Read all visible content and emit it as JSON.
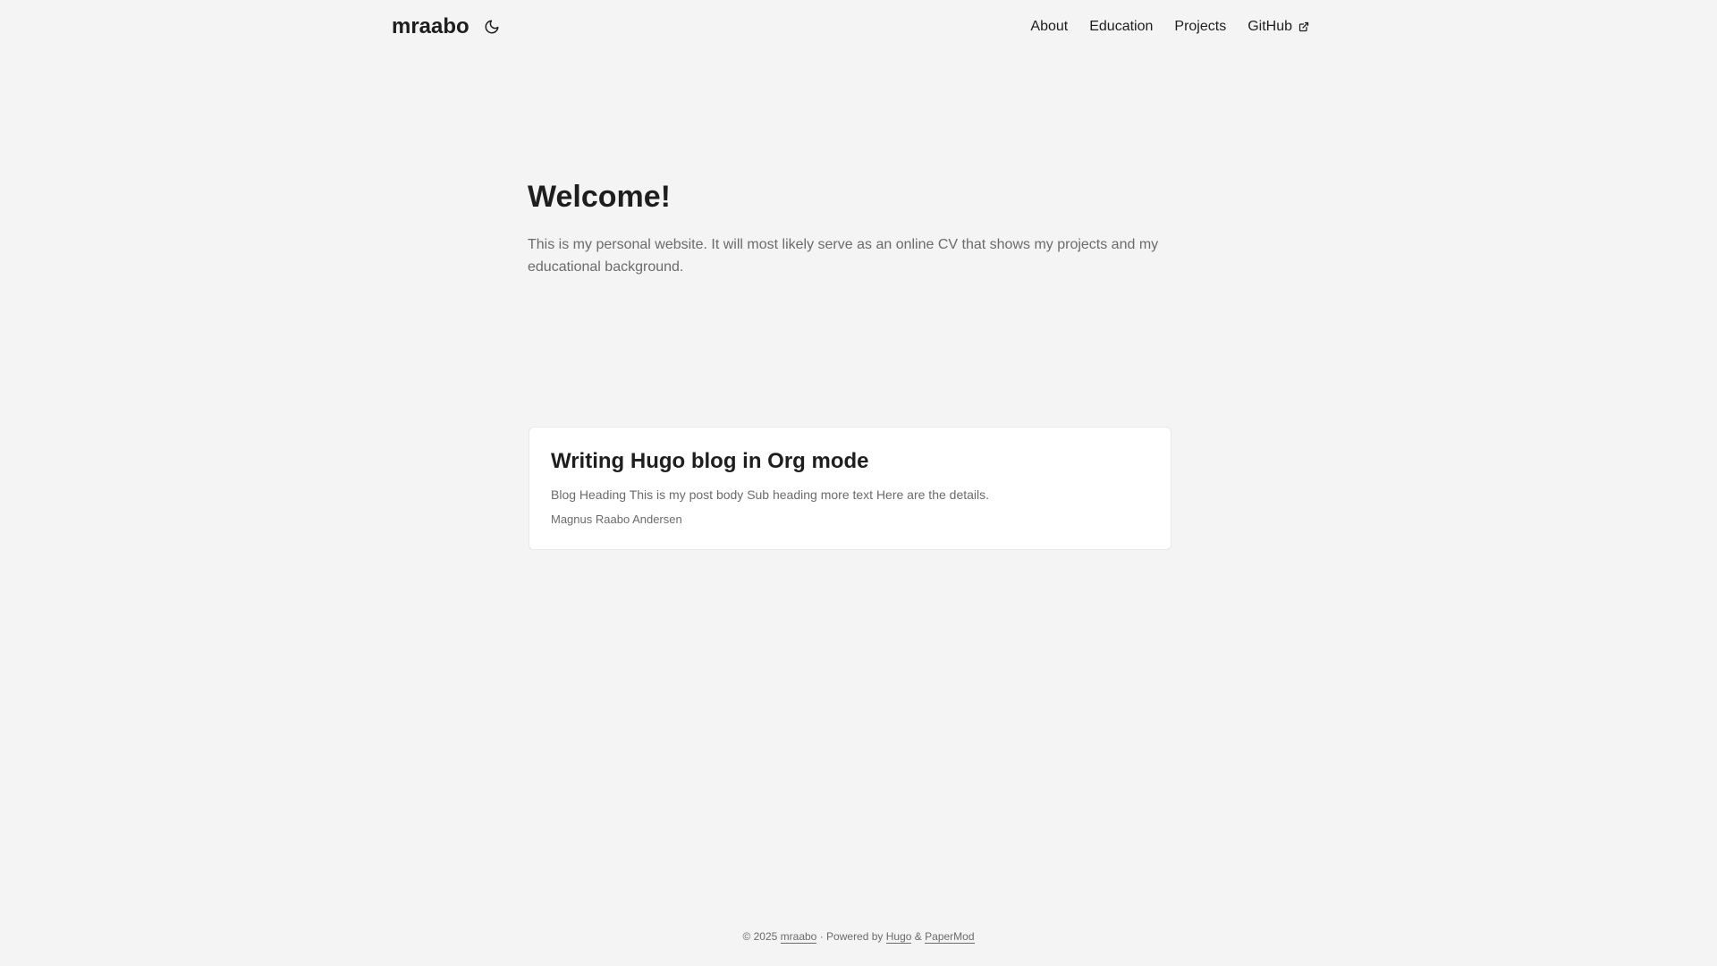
{
  "header": {
    "logo": "mraabo",
    "theme_toggle_icon": "moon-icon",
    "menu": [
      {
        "label": "About"
      },
      {
        "label": "Education"
      },
      {
        "label": "Projects"
      },
      {
        "label": "GitHub",
        "icon": "external-link-icon"
      }
    ]
  },
  "main": {
    "title": "Welcome!",
    "text": "This is my personal website. It will most likely serve as an online CV that shows my projects and my educational background."
  },
  "posts": [
    {
      "title": "Writing Hugo blog in Org mode",
      "summary": "Blog Heading This is my post body Sub heading more text Here are the details.",
      "author": "Magnus Raabo Andersen"
    }
  ],
  "footer": {
    "copyright": "© 2025",
    "site_link": "mraabo",
    "separator": "·",
    "powered_by": "Powered by",
    "hugo_link": "Hugo",
    "ampersand": "&",
    "theme_link": "PaperMod"
  },
  "colors": {
    "background": "#f4f4f4",
    "card": "#ffffff",
    "primary_text": "#1e1e1e",
    "secondary_text": "#6b6b6b"
  }
}
